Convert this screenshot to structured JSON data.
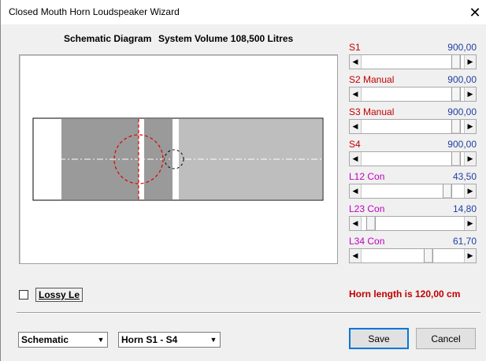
{
  "window": {
    "title": "Closed Mouth Horn Loudspeaker Wizard",
    "close_glyph": "✕"
  },
  "header": {
    "diagram_label": "Schematic Diagram",
    "volume_label": "System Volume 108,500 Litres"
  },
  "sliders": [
    {
      "label": "S1",
      "value": "900,00",
      "label_color": "#c00000",
      "position_fraction": 0.97
    },
    {
      "label": "S2 Manual",
      "value": "900,00",
      "label_color": "#c00000",
      "position_fraction": 0.97
    },
    {
      "label": "S3 Manual",
      "value": "900,00",
      "label_color": "#c00000",
      "position_fraction": 0.97
    },
    {
      "label": "S4",
      "value": "900,00",
      "label_color": "#c00000",
      "position_fraction": 0.97
    },
    {
      "label": "L12 Con",
      "value": "43,50",
      "label_color": "#c000c0",
      "position_fraction": 0.87
    },
    {
      "label": "L23 Con",
      "value": "14,80",
      "label_color": "#c000c0",
      "position_fraction": 0.05
    },
    {
      "label": "L34 Con",
      "value": "61,70",
      "label_color": "#c000c0",
      "position_fraction": 0.67
    }
  ],
  "options": {
    "lossy_label": "Lossy Le",
    "lossy_checked": false
  },
  "status": {
    "horn_length": "Horn length is 120,00 cm"
  },
  "footer": {
    "view_select": "Schematic",
    "horn_select": "Horn S1 - S4",
    "save_label": "Save",
    "cancel_label": "Cancel"
  }
}
